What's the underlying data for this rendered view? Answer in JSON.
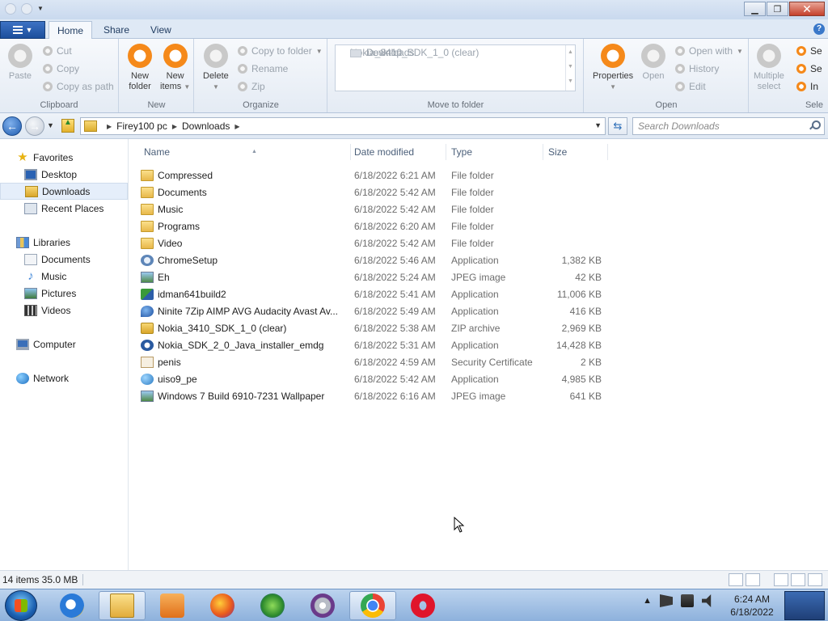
{
  "tabs": [
    "Home",
    "Share",
    "View"
  ],
  "ribbon": {
    "clipboard": {
      "label": "Clipboard",
      "paste": "Paste",
      "cut": "Cut",
      "copy": "Copy",
      "copy_as_path": "Copy as path"
    },
    "new": {
      "label": "New",
      "new_folder_1": "New",
      "new_folder_2": "folder",
      "new_items_1": "New",
      "new_items_2": "items"
    },
    "organize": {
      "label": "Organize",
      "delete": "Delete",
      "copy_to_folder": "Copy to folder",
      "rename": "Rename",
      "zip": "Zip"
    },
    "move_to_folder": {
      "label": "Move to folder",
      "items": [
        "Nokia_3410_SDK_1_0 (clear)",
        "Desktop",
        "Downloads"
      ]
    },
    "open": {
      "label": "Open",
      "properties": "Properties",
      "open": "Open",
      "open_with": "Open with",
      "history": "History",
      "edit": "Edit"
    },
    "select": {
      "label": "Sele",
      "multiple_1": "Multiple",
      "multiple_2": "select",
      "se1": "Se",
      "se2": "Se",
      "in": "In"
    }
  },
  "address": {
    "crumbs": [
      "Firey100 pc",
      "Downloads"
    ],
    "search_placeholder": "Search Downloads"
  },
  "navpane": {
    "favorites": "Favorites",
    "desktop": "Desktop",
    "downloads": "Downloads",
    "recent": "Recent Places",
    "libraries": "Libraries",
    "documents": "Documents",
    "music": "Music",
    "pictures": "Pictures",
    "videos": "Videos",
    "computer": "Computer",
    "network": "Network"
  },
  "columns": {
    "name": "Name",
    "date": "Date modified",
    "type": "Type",
    "size": "Size"
  },
  "files": [
    {
      "name": "Compressed",
      "date": "6/18/2022 6:21 AM",
      "type": "File folder",
      "size": "",
      "icon": "folder"
    },
    {
      "name": "Documents",
      "date": "6/18/2022 5:42 AM",
      "type": "File folder",
      "size": "",
      "icon": "folder"
    },
    {
      "name": "Music",
      "date": "6/18/2022 5:42 AM",
      "type": "File folder",
      "size": "",
      "icon": "folder"
    },
    {
      "name": "Programs",
      "date": "6/18/2022 6:20 AM",
      "type": "File folder",
      "size": "",
      "icon": "folder"
    },
    {
      "name": "Video",
      "date": "6/18/2022 5:42 AM",
      "type": "File folder",
      "size": "",
      "icon": "folder"
    },
    {
      "name": "ChromeSetup",
      "date": "6/18/2022 5:46 AM",
      "type": "Application",
      "size": "1,382 KB",
      "icon": "app"
    },
    {
      "name": "Eh",
      "date": "6/18/2022 5:24 AM",
      "type": "JPEG image",
      "size": "42 KB",
      "icon": "jpeg"
    },
    {
      "name": "idman641build2",
      "date": "6/18/2022 5:41 AM",
      "type": "Application",
      "size": "11,006 KB",
      "icon": "idm"
    },
    {
      "name": "Ninite 7Zip AIMP AVG Audacity Avast Av...",
      "date": "6/18/2022 5:49 AM",
      "type": "Application",
      "size": "416 KB",
      "icon": "ninite"
    },
    {
      "name": "Nokia_3410_SDK_1_0 (clear)",
      "date": "6/18/2022 5:38 AM",
      "type": "ZIP archive",
      "size": "2,969 KB",
      "icon": "zip"
    },
    {
      "name": "Nokia_SDK_2_0_Java_installer_emdg",
      "date": "6/18/2022 5:31 AM",
      "type": "Application",
      "size": "14,428 KB",
      "icon": "java"
    },
    {
      "name": "penis",
      "date": "6/18/2022 4:59 AM",
      "type": "Security Certificate",
      "size": "2 KB",
      "icon": "cert"
    },
    {
      "name": "uiso9_pe",
      "date": "6/18/2022 5:42 AM",
      "type": "Application",
      "size": "4,985 KB",
      "icon": "uiso"
    },
    {
      "name": "Windows 7 Build 6910-7231 Wallpaper",
      "date": "6/18/2022 6:16 AM",
      "type": "JPEG image",
      "size": "641 KB",
      "icon": "jpeg"
    }
  ],
  "status": {
    "text": "14 items  35.0 MB"
  },
  "taskbar": {
    "time": "6:24 AM",
    "date": "6/18/2022"
  }
}
